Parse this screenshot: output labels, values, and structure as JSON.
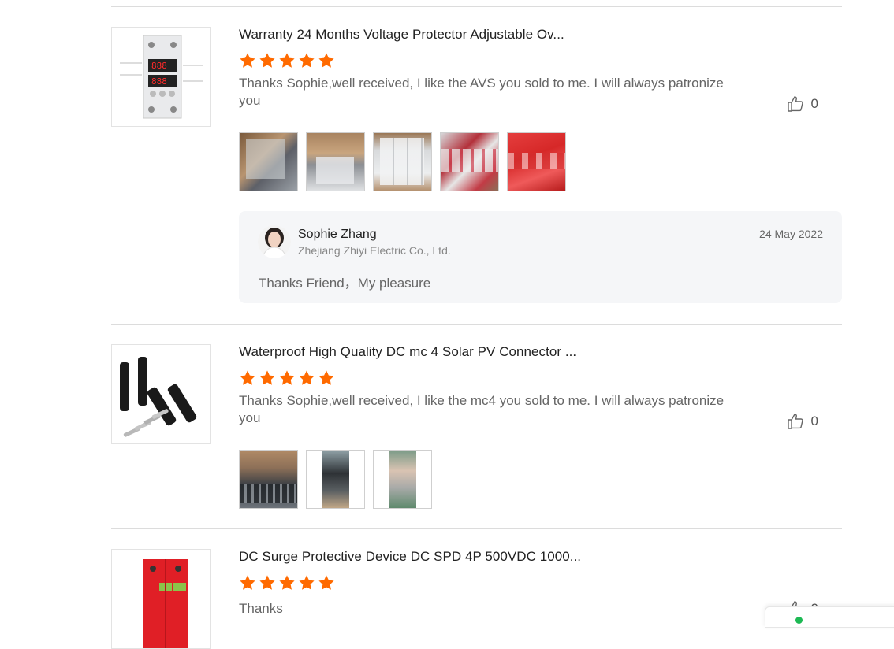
{
  "reviews": [
    {
      "title": "Warranty 24 Months Voltage Protector Adjustable Ov...",
      "rating": 5,
      "text": "Thanks Sophie,well received, I like the AVS you sold to me. I will always patronize you",
      "likes": "0",
      "photo_count": 5,
      "reply": {
        "name": "Sophie Zhang",
        "company": "Zhejiang Zhiyi Electric Co., Ltd.",
        "date": "24 May 2022",
        "message": "Thanks Friend，My pleasure"
      }
    },
    {
      "title": "Waterproof High Quality DC mc 4 Solar PV Connector ...",
      "rating": 5,
      "text": "Thanks Sophie,well received, I like the mc4 you sold to me. I will always patronize you",
      "likes": "0",
      "photo_count": 3
    },
    {
      "title": "DC Surge Protective Device DC SPD 4P 500VDC 1000...",
      "rating": 5,
      "text": "Thanks",
      "likes": "0"
    }
  ],
  "colors": {
    "star": "#ff6a00",
    "divider": "#dcdcdc",
    "reply_bg": "#f5f6f8",
    "online": "#1db954"
  },
  "icons": {
    "like": "thumbs-up-icon",
    "star": "star-icon"
  }
}
